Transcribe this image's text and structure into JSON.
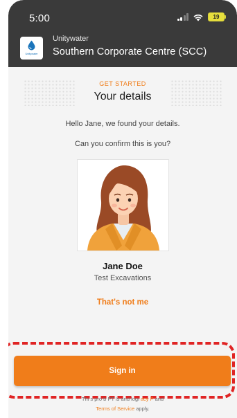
{
  "status_bar": {
    "time": "5:00",
    "battery": "19"
  },
  "header": {
    "org_name": "Unitywater",
    "site_name": "Southern Corporate Centre (SCC)",
    "logo_text": "Unitywater",
    "logo_icon": "water-drop-icon"
  },
  "content": {
    "eyebrow": "GET STARTED",
    "title": "Your details",
    "greeting": "Hello Jane, we found your details.",
    "question": "Can you confirm this is you?",
    "person_name": "Jane Doe",
    "person_company": "Test Excavations",
    "not_me_label": "That's not me",
    "sign_in_label": "Sign in",
    "footer_line1_a": "Thi",
    "footer_line1_b": "s pro",
    "footer_line1_c": "b",
    "footer_line1_d": "PT",
    "footer_line1_e": "ls and",
    "footer_line1_f": "logi",
    "footer_privacy": "acy P",
    "footer_line1_g": "and",
    "footer_terms": "Terms of Service",
    "footer_apply": "apply."
  },
  "colors": {
    "accent": "#f07d1a",
    "header_bg": "#3a3a3a",
    "highlight": "#e02424"
  }
}
